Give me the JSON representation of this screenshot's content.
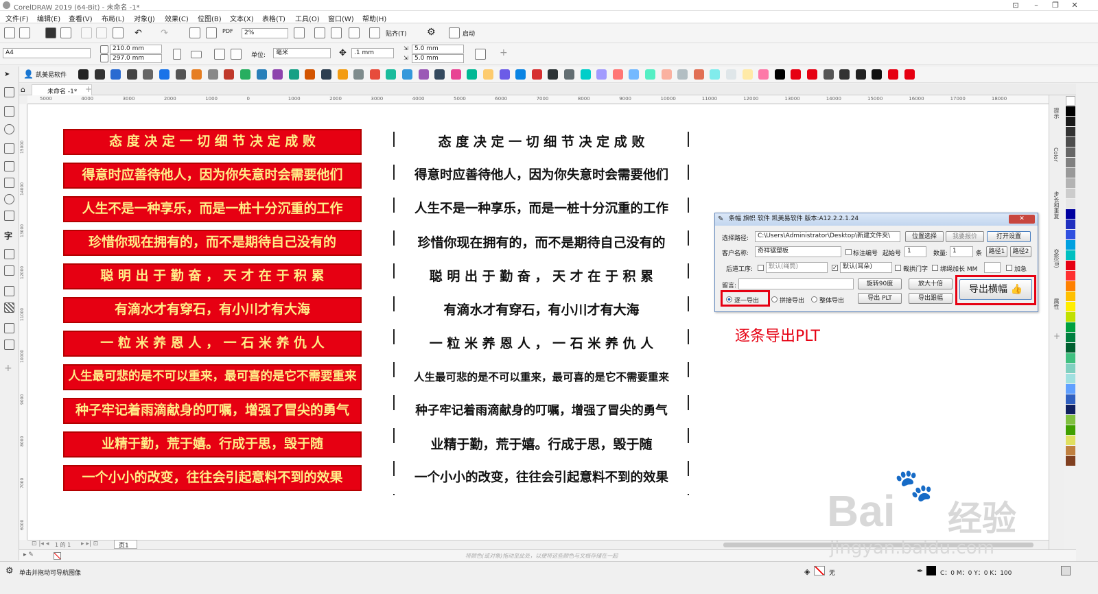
{
  "window": {
    "title": "CorelDRAW 2019 (64-Bit) - 未命名 -1*"
  },
  "menu": [
    "文件(F)",
    "编辑(E)",
    "查看(V)",
    "布局(L)",
    "对象(J)",
    "效果(C)",
    "位图(B)",
    "文本(X)",
    "表格(T)",
    "工具(O)",
    "窗口(W)",
    "帮助(H)"
  ],
  "std_toolbar": {
    "zoom": "2%",
    "snap_label": "贴齐(T)",
    "launch_label": "启动"
  },
  "property_bar": {
    "page_size": "A4",
    "width": "210.0 mm",
    "height": "297.0 mm",
    "unit_label": "单位:",
    "unit": "毫米",
    "nudge": ".1 mm",
    "dup_x": "5.0 mm",
    "dup_y": "5.0 mm"
  },
  "plugin_toolbar": {
    "brand": "凯美易软件"
  },
  "document_tab": "未命名 -1*",
  "ruler_h": [
    "5000",
    "4000",
    "3000",
    "2000",
    "1000",
    "0",
    "1000",
    "2000",
    "3000",
    "4000",
    "5000",
    "6000",
    "7000",
    "8000",
    "9000",
    "10000",
    "11000",
    "12000",
    "13000",
    "14000",
    "15000",
    "16000",
    "17000",
    "18000"
  ],
  "ruler_v": [
    "15000",
    "14000",
    "13000",
    "12000",
    "11000",
    "10000",
    "9000",
    "8000",
    "7000",
    "6000"
  ],
  "banners": [
    "态 度 决 定 一 切 细 节 决 定 成 败",
    "得意时应善待他人，因为你失意时会需要他们",
    "人生不是一种享乐，而是一桩十分沉重的工作",
    "珍惜你现在拥有的，而不是期待自己没有的",
    "聪 明 出 于 勤 奋 ， 天 才 在 于 积 累",
    "有滴水才有穿石，有小川才有大海",
    "一 粒 米 养 恩 人 ， 一 石 米 养 仇 人",
    "人生最可悲的是不可以重来，最可喜的是它不需要重来",
    "种子牢记着雨滴献身的叮嘱，增强了冒尖的勇气",
    "业精于勤，荒于嬉。行成于思，毁于随",
    "一个小小的改变，往往会引起意料不到的效果"
  ],
  "dialog": {
    "title": "条幅 旗帜 软件 凯美易软件 版本:A12.2.2.1.24",
    "path_label": "选择路径:",
    "path_value": "C:\\Users\\Administrator\\Desktop\\新建文件夹\\",
    "btn_location": "位置选择",
    "btn_quote": "我要报价",
    "btn_settings": "打开设置",
    "customer_label": "客户名称:",
    "customer_value": "奇祥锯塑板",
    "mark_number": "标注编号",
    "start_label": "起始号",
    "start_value": "1",
    "qty_label": "数量:",
    "qty_value": "1",
    "qty_unit": "条",
    "btn_path1": "路径1",
    "btn_path2": "路径2",
    "process_label": "后道工序:",
    "process_value": "默认(绳筒)",
    "ear_value": "默认(耳朵)",
    "cut_door": "裁拱门字",
    "rope_extend": "绑绳加长 MM",
    "urgent": "加急",
    "note_label": "留言:",
    "btn_rotate": "旋转90度",
    "btn_enlarge": "放大十倍",
    "btn_export_banner": "导出横幅",
    "radio_each": "逐一导出",
    "radio_join": "拼接导出",
    "radio_whole": "整体导出",
    "btn_export_plt": "导出 PLT",
    "btn_export_sample": "导出跟幅"
  },
  "annotation": "逐条导出PLT",
  "page_nav": {
    "info": "1 的 1",
    "page_tab": "页1"
  },
  "doc_palette_hint": "将颜色(或对象)拖动至此处，以便将这些颜色与文档存储在一起",
  "status": {
    "hint": "单击并拖动可导航图像",
    "fill": "无",
    "outline": "C：0 M：0 Y：0 K：100"
  },
  "dock_tabs": [
    "提示",
    "Color",
    "步长和重复",
    "变形(B)",
    "属性"
  ],
  "palette_colors": [
    "#ffffff",
    "#000000",
    "#1a1a1a",
    "#333333",
    "#4d4d4d",
    "#666666",
    "#808080",
    "#999999",
    "#b3b3b3",
    "#cccccc",
    "#e6e6e6",
    "#0000a0",
    "#2030c0",
    "#3050e0",
    "#00a0e0",
    "#00c0c0",
    "#e60012",
    "#ff3030",
    "#ff8000",
    "#ffc000",
    "#ffee00",
    "#c0e000",
    "#00a040",
    "#008040",
    "#006030",
    "#40c080",
    "#80d0c0",
    "#a0e0e0",
    "#60a0ff",
    "#3060c0",
    "#102060",
    "#80c040",
    "#40a000",
    "#e0e060",
    "#c08040",
    "#804020"
  ],
  "watermark": {
    "brand": "Bai",
    "cn": "经验",
    "url": "jingyan.baidu.com"
  }
}
